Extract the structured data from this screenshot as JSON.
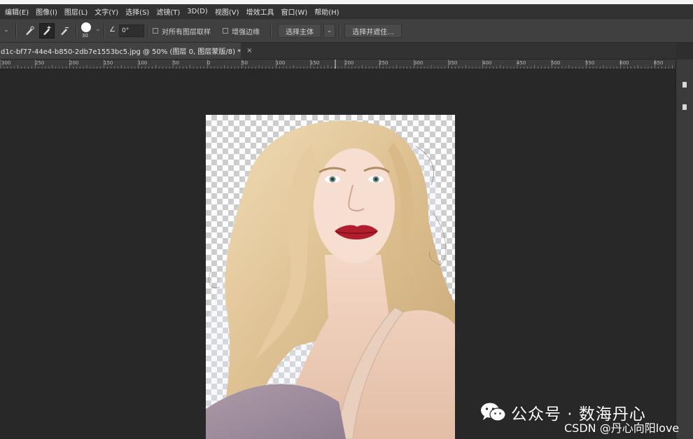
{
  "menu": {
    "items": [
      "编辑(E)",
      "图像(I)",
      "图层(L)",
      "文字(Y)",
      "选择(S)",
      "滤镜(T)",
      "3D(D)",
      "视图(V)",
      "增效工具",
      "窗口(W)",
      "帮助(H)"
    ]
  },
  "options": {
    "brush_size": "30",
    "angle_value": "0°",
    "sample_all_layers_label": "对所有图层取样",
    "sample_all_layers_checked": false,
    "enhance_edge_label": "增强边缘",
    "enhance_edge_checked": false,
    "select_subject_label": "选择主体",
    "select_and_mask_label": "选择并遮住..."
  },
  "document": {
    "tab_title": "d1c-bf77-44e4-b850-2db7e1553bc5.jpg @ 50% (图层 0, 图层蒙版/8) *",
    "close_glyph": "×"
  },
  "ruler": {
    "labels": [
      "300",
      "250",
      "200",
      "150",
      "100",
      "50",
      "0",
      "50",
      "100",
      "150",
      "200",
      "250",
      "300",
      "350",
      "400",
      "450",
      "500",
      "550",
      "600",
      "650"
    ]
  },
  "watermark": {
    "wechat_text": "公众号 · 数海丹心",
    "csdn_text": "CSDN @丹心向阳love"
  },
  "icons": {
    "brush_add": "brush-add-icon",
    "brush_quick": "quick-selection-icon",
    "brush_subtract": "brush-subtract-icon",
    "wechat": "wechat-icon"
  }
}
